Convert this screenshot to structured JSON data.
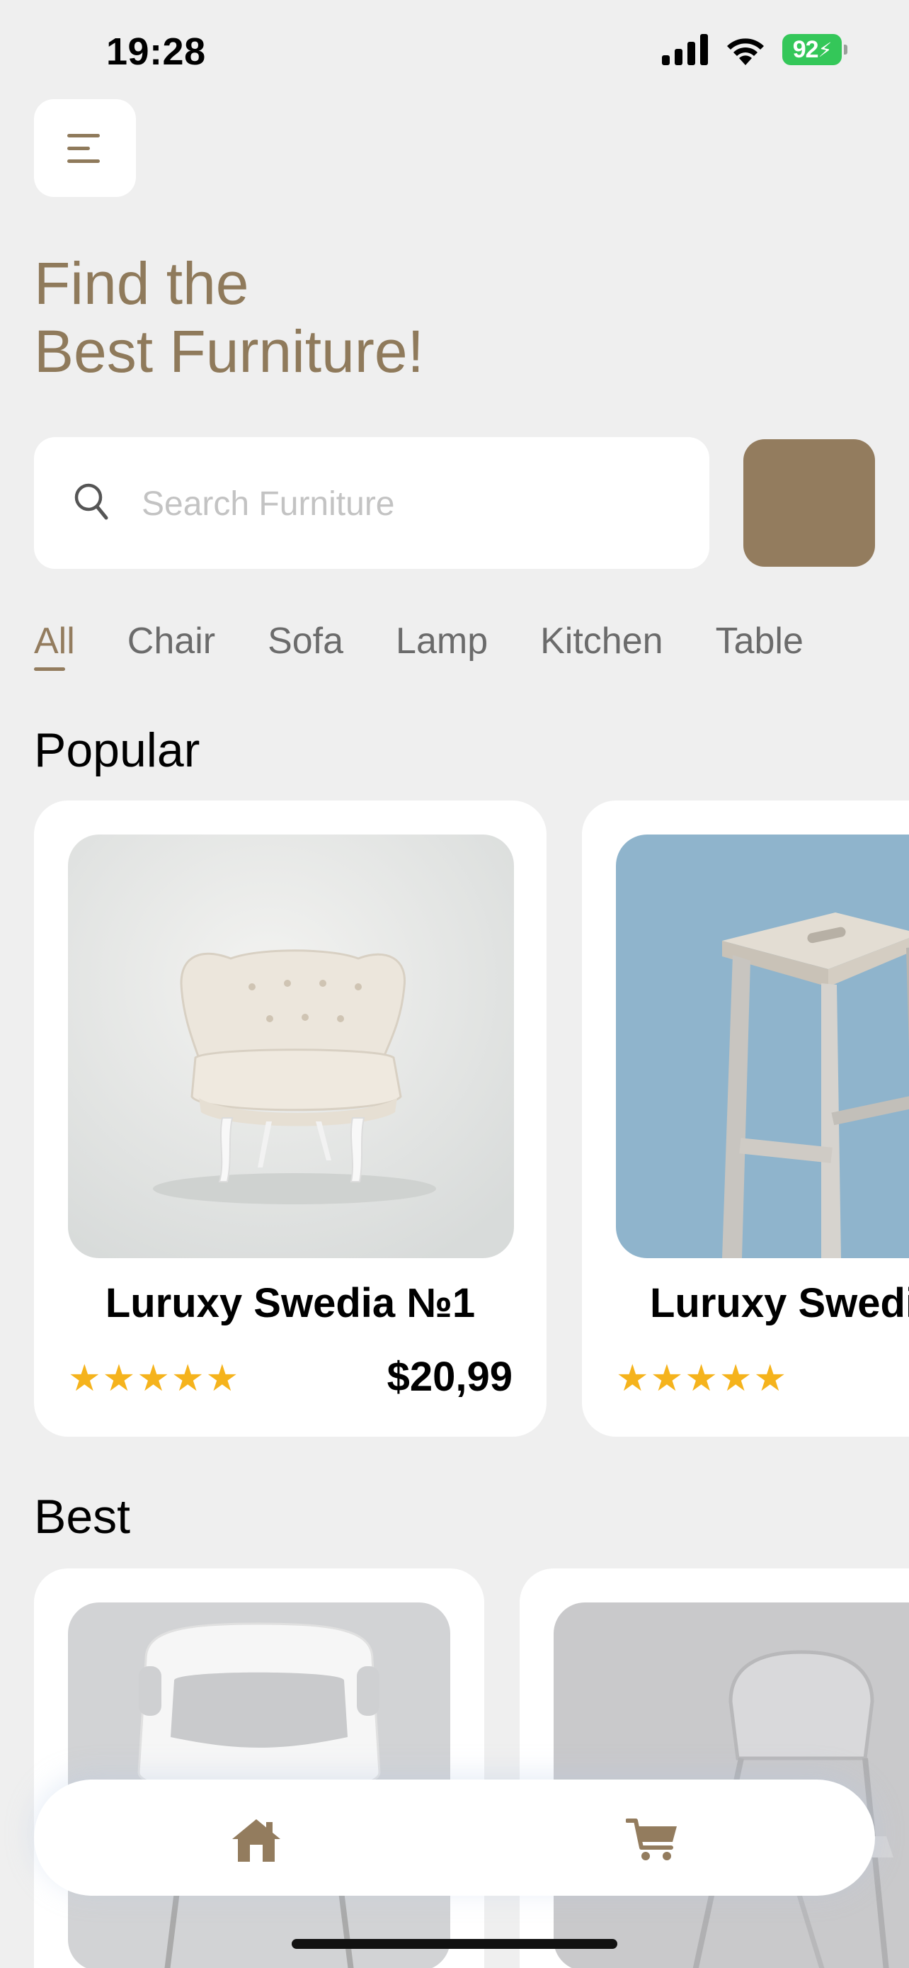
{
  "status_bar": {
    "time": "19:28",
    "battery": "92"
  },
  "header": {
    "title_line1": "Find the",
    "title_line2": "Best Furniture!"
  },
  "search": {
    "placeholder": "Search Furniture",
    "value": ""
  },
  "categories": [
    "All",
    "Chair",
    "Sofa",
    "Lamp",
    "Kitchen",
    "Table"
  ],
  "active_category": "All",
  "sections": {
    "popular": {
      "title": "Popular",
      "items": [
        {
          "name": "Luruxy Swedia №1",
          "rating": 5,
          "stars": "★★★★★",
          "price": "$20,99"
        },
        {
          "name": "Luruxy Swedia",
          "rating": 5,
          "stars": "★★★★★"
        }
      ]
    },
    "best": {
      "title": "Best"
    }
  },
  "nav": {
    "items": [
      "home-icon",
      "cart-icon"
    ]
  },
  "colors": {
    "accent": "#937c5e",
    "heading": "#8f7a5b",
    "star": "#f5b31c",
    "background": "#efefef"
  }
}
